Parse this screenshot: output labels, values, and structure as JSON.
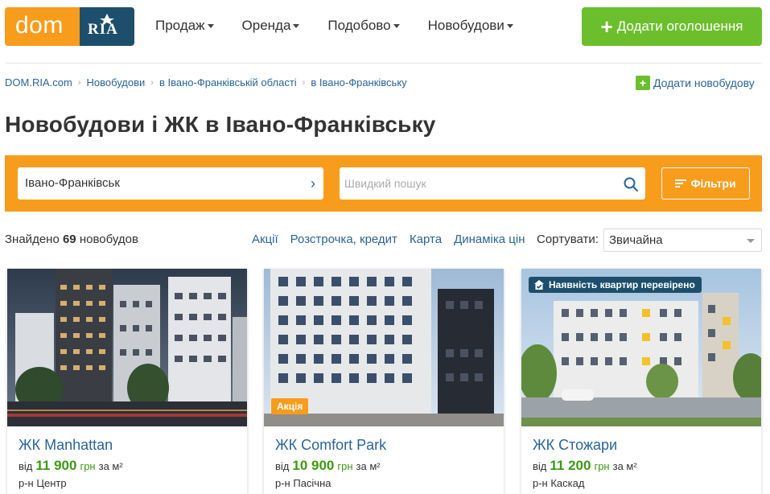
{
  "header": {
    "logo_dom": "dom",
    "logo_ria": "RIA",
    "nav": [
      {
        "label": "Продаж"
      },
      {
        "label": "Оренда"
      },
      {
        "label": "Подобово"
      },
      {
        "label": "Новобудови"
      }
    ],
    "add_listing": "Додати оголошення"
  },
  "breadcrumbs": [
    "DOM.RIA.com",
    "Новобудови",
    "в Івано-Франківській області",
    "в Івано-Франківську"
  ],
  "add_new_building": "Додати новобудову",
  "page_title": "Новобудови і ЖК в Івано-Франківську",
  "search": {
    "city": "Івано-Франківськ",
    "quick_placeholder": "Швидкий пошук",
    "filters_label": "Фільтри"
  },
  "results": {
    "found_prefix": "Знайдено",
    "found_count": "69",
    "found_suffix": "новобудов",
    "links": [
      "Акції",
      "Розстрочка, кредит",
      "Карта",
      "Динаміка цін"
    ],
    "sort_label": "Сортувати:",
    "sort_value": "Звичайна"
  },
  "cards": [
    {
      "title": "ЖК Manhattan",
      "price_prefix": "від",
      "price": "11 900",
      "currency": "грн",
      "unit": "за м²",
      "district": "р-н Центр"
    },
    {
      "title": "ЖК Comfort Park",
      "price_prefix": "від",
      "price": "10 900",
      "currency": "грн",
      "unit": "за м²",
      "district": "р-н Пасічна",
      "badge": "Акція"
    },
    {
      "title": "ЖК Стожари",
      "price_prefix": "від",
      "price": "11 200",
      "currency": "грн",
      "unit": "за м²",
      "district": "р-н Каскад",
      "badge": "Наявність квартир перевірено"
    }
  ],
  "colors": {
    "brand_orange": "#f89c1c",
    "brand_navy": "#1d4f6c",
    "accent_green": "#6cbf2c",
    "link_blue": "#2a6496",
    "price_green": "#3a9a12"
  }
}
